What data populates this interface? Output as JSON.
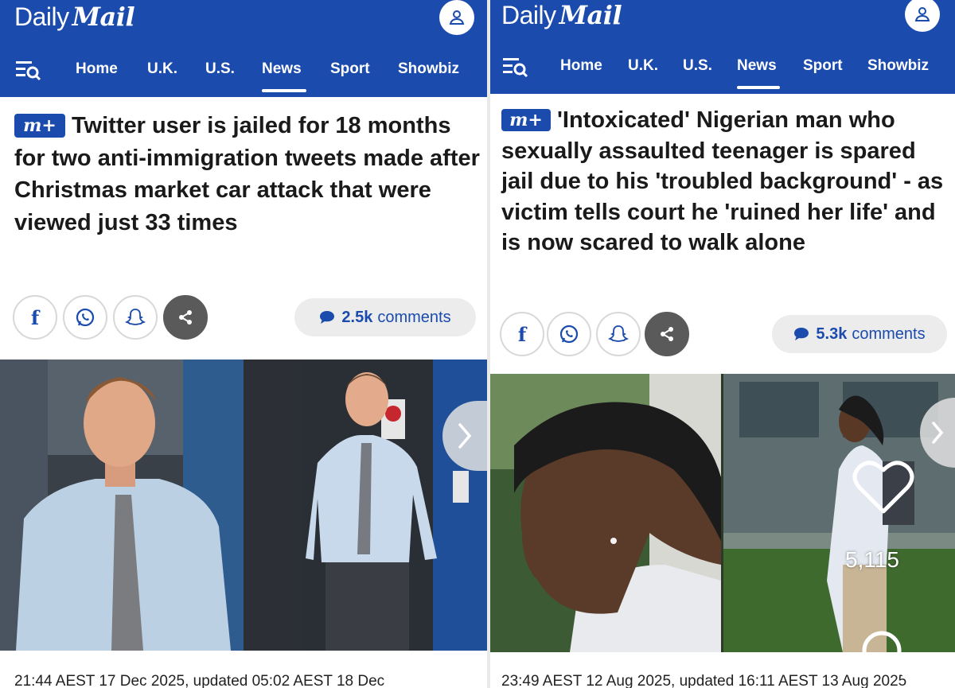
{
  "left": {
    "brand": {
      "daily": "Daily",
      "mail": "Mail"
    },
    "nav": {
      "items": [
        "Home",
        "U.K.",
        "U.S.",
        "News",
        "Sport",
        "Showbiz"
      ],
      "active": "News"
    },
    "badge": "m+",
    "headline": "Twitter user is jailed for 18 months for two anti-immigration tweets made after Christmas market car attack that were viewed just 33 times",
    "share": {
      "facebook_label": "f",
      "comments_count": "2.5k",
      "comments_label": "comments"
    },
    "timestamp": "21:44 AEST 17 Dec 2025, updated 05:02 AEST 18 Dec"
  },
  "right": {
    "brand": {
      "daily": "Daily",
      "mail": "Mail"
    },
    "nav": {
      "items": [
        "Home",
        "U.K.",
        "U.S.",
        "News",
        "Sport",
        "Showbiz"
      ],
      "active": "News"
    },
    "badge": "m+",
    "headline": "'Intoxicated' Nigerian man who sexually assaulted teenager is spared jail due to his 'troubled background' - as victim tells court he 'ruined her life' and is now scared to walk alone",
    "share": {
      "facebook_label": "f",
      "comments_count": "5.3k",
      "comments_label": "comments"
    },
    "timestamp": "23:49 AEST 12 Aug 2025, updated 16:11 AEST 13 Aug 2025"
  },
  "overlay": {
    "like_count": "5,115"
  },
  "colors": {
    "brand_blue": "#1a4bad",
    "pill_bg": "#ececec",
    "share_dark": "#5a5a5a"
  },
  "icons": [
    "user-icon",
    "menu-search-icon",
    "facebook-icon",
    "whatsapp-icon",
    "snapchat-icon",
    "share-icon",
    "comment-bubble-icon",
    "chevron-right-icon",
    "heart-icon",
    "search-icon"
  ]
}
